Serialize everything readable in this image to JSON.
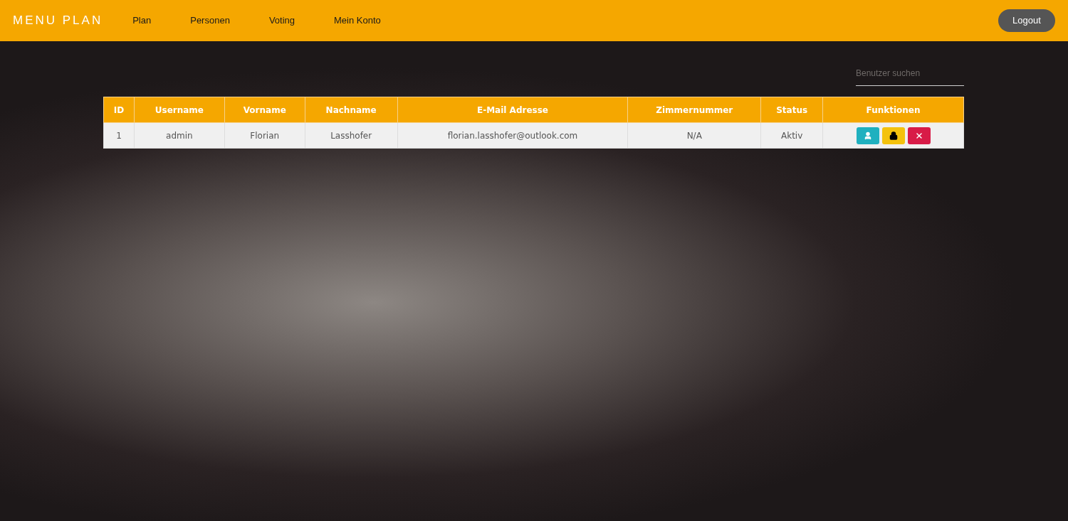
{
  "navbar": {
    "brand": "MENU PLAN",
    "items": [
      "Plan",
      "Personen",
      "Voting",
      "Mein Konto"
    ],
    "logout": "Logout"
  },
  "search": {
    "placeholder": "Benutzer suchen"
  },
  "table": {
    "columns": [
      "ID",
      "Username",
      "Vorname",
      "Nachname",
      "E-Mail Adresse",
      "Zimmernummer",
      "Status",
      "Funktionen"
    ],
    "rows": [
      {
        "cells": [
          "1",
          "admin",
          "Florian",
          "Lasshofer",
          "florian.lasshofer@outlook.com",
          "N/A",
          "Aktiv"
        ],
        "actions": [
          {
            "kind": "profile"
          },
          {
            "kind": "lock"
          },
          {
            "kind": "delete"
          }
        ]
      }
    ]
  }
}
